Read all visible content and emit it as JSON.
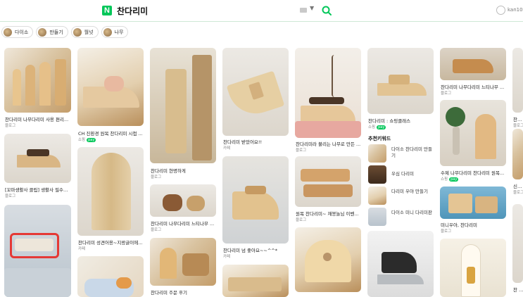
{
  "header": {
    "logo_letter": "N",
    "query": "찬다리미",
    "user_label": "kan10..."
  },
  "chips": [
    {
      "label": "다이소"
    },
    {
      "label": "만들기"
    },
    {
      "label": "월넛"
    },
    {
      "label": "나무"
    }
  ],
  "cards": [
    {
      "title": "찬다리미 나무다리미 사용 편리...",
      "source": "블로그"
    },
    {
      "title": "[꼬마생활사 클립] 생활사 필수템...",
      "source": "블로그"
    },
    {
      "title": "CH 진환경 원목 찬다리미 시접 ...",
      "source": "쇼핑",
      "pay": "pay"
    },
    {
      "title": "찬다리미 성견어용~지랑글이에...",
      "source": "카페"
    },
    {
      "title": "찬다리미 현명하게",
      "source": "블로그"
    },
    {
      "title": "찬다리미 나무다리미 느티나무 ...",
      "source": "블로그"
    },
    {
      "title": "찬다리미 주문 후기",
      "source": ""
    },
    {
      "title": "찬다리미 받았어요!!",
      "source": "카페"
    },
    {
      "title": "찬다리미 넘 좋아요~~^^*",
      "source": "카페"
    },
    {
      "title": "찬다리미라 불리는 나무로 만든 ...",
      "source": "블로그"
    },
    {
      "title": "원목 찬다리미~ 재봉놀님 이벤...",
      "source": "블로그"
    },
    {
      "title": "찬다리미 : 쇼핑클래스",
      "source": "쇼핑",
      "pay": "pay"
    },
    {
      "title": "찬다리미 나무다리미 느티나무 ...",
      "source": "블로그"
    },
    {
      "title": "수제 나무다리미 찬다리미 원목...",
      "source": "쇼핑",
      "pay": "pay"
    },
    {
      "title": "미니우아, 찬다리미",
      "source": "블로그"
    },
    {
      "title": "찬다...",
      "source": "블로그"
    },
    {
      "title": "신상...",
      "source": "블로그"
    },
    {
      "title": "찬 다...",
      "source": ""
    }
  ],
  "keywords": {
    "title": "추천키워드",
    "items": [
      {
        "label": "다이소 찬다리미 만들기"
      },
      {
        "label": "우심 다리미"
      },
      {
        "label": "다리미 우야 만들기"
      },
      {
        "label": "다이소 미니 다리미판"
      }
    ]
  }
}
